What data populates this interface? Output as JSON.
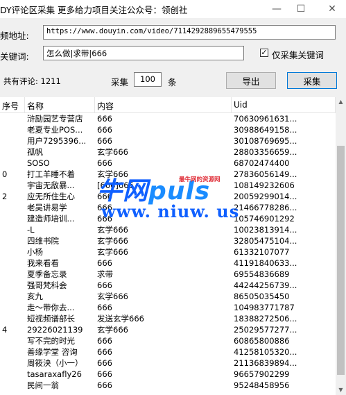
{
  "window": {
    "title": "DY评论区采集   更多给力项目关注公众号：领创社",
    "minimize": "—",
    "maximize": "☐",
    "close": "✕"
  },
  "form": {
    "video_url_label": "频地址:",
    "video_url": "https://www.douyin.com/video/7114292889655479555",
    "keyword_label": "关键词:",
    "keywords": "怎么做|求带|666",
    "only_keyword_checked": "✓",
    "only_keyword_label": "仅采集关键词"
  },
  "stats": {
    "total_label": "共有评论: 1211",
    "collect_label": "采集",
    "collect_count": "100",
    "unit": "条",
    "export_button": "导出",
    "collect_button": "采集"
  },
  "table": {
    "columns": [
      "序号",
      "名称",
      "内容",
      "Uid"
    ],
    "rows": [
      [
        "",
        "浒励园艺专营店",
        "666",
        "70630961631..."
      ],
      [
        "",
        "老夏专业POS...",
        "666",
        "30988649158..."
      ],
      [
        "",
        "用户7295396...",
        "666",
        "30108769695..."
      ],
      [
        "",
        "孤帆",
        "玄学666",
        "28803356659..."
      ],
      [
        "",
        "SOSO",
        "666",
        "68702474400"
      ],
      [
        "0",
        "打工羊睡不着",
        "玄学666",
        "27836056149..."
      ],
      [
        "",
        "宇宙无敌暴...",
        "[666]666",
        "108149232606"
      ],
      [
        "2",
        "应无所住生心",
        "666",
        "20059299014..."
      ],
      [
        "",
        "老吴讲易学",
        "666",
        "21466778286..."
      ],
      [
        "",
        "建造师培训...",
        "666",
        "105746901292"
      ],
      [
        "",
        "-L",
        "玄学666",
        "10023813914..."
      ],
      [
        "",
        "四维书院",
        "玄学666",
        "32805475104..."
      ],
      [
        "",
        "小杨",
        "玄学666",
        "61332107077"
      ],
      [
        "",
        "我来看看",
        "666",
        "41191840633..."
      ],
      [
        "",
        "夏季备忘录",
        "求带",
        "69554836689"
      ],
      [
        "",
        "强哥梵科会",
        "666",
        "44244256739..."
      ],
      [
        "",
        "亥九",
        "玄学666",
        "86505035450"
      ],
      [
        "",
        "走～带你去...",
        "666",
        "104983771787"
      ],
      [
        "",
        "短视频谱部长",
        "发送玄学666",
        "18388272506..."
      ],
      [
        "4",
        "29226021139",
        "玄学666",
        "25029577277..."
      ],
      [
        "",
        "写不完的时光",
        "666",
        "60865800886"
      ],
      [
        "",
        "善缘学堂 咨询",
        "666",
        "41258105320..."
      ],
      [
        "",
        "周筱泱（小一）",
        "666",
        "21136839894..."
      ],
      [
        "",
        "tasaraxafly26",
        "666",
        "96657902299"
      ],
      [
        "",
        "民间一翁",
        "666",
        "95248458956"
      ]
    ]
  },
  "watermark": {
    "brand_a": "牛网",
    "brand_b": "puls",
    "tagline": "最牛网的资源网",
    "url": "www. niuw. us"
  },
  "colors": {
    "accent": "#0078d7",
    "watermark_blue": "#1060ff",
    "watermark_red": "#e0303a"
  }
}
